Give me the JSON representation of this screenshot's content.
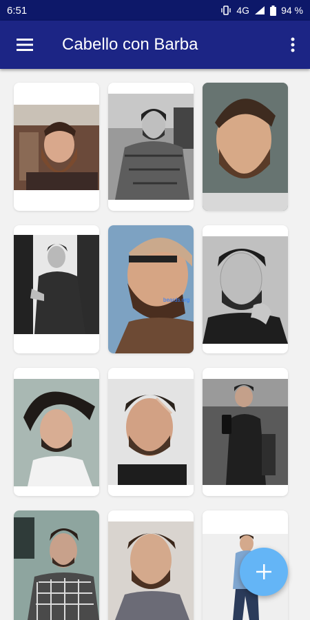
{
  "status_bar": {
    "time": "6:51",
    "network": "4G",
    "battery": "94 %",
    "icons": [
      "vibrate-icon",
      "signal-icon",
      "battery-icon"
    ]
  },
  "app_bar": {
    "title": "Cabello con Barba",
    "menu_icon": "hamburger-menu-icon",
    "overflow_icon": "more-vert-icon"
  },
  "gallery": {
    "watermark": "beards.org",
    "items": [
      {
        "name": "bearded-man-barbershop"
      },
      {
        "name": "bearded-man-plaid-shirt"
      },
      {
        "name": "bearded-man-side-part"
      },
      {
        "name": "man-glasses-suit"
      },
      {
        "name": "man-sunglasses-profile"
      },
      {
        "name": "bearded-man-hand-on-face"
      },
      {
        "name": "man-long-hair-windswept"
      },
      {
        "name": "man-fade-haircut"
      },
      {
        "name": "man-mirror-selfie"
      },
      {
        "name": "man-checkered-shirt"
      },
      {
        "name": "man-slick-back-beard"
      },
      {
        "name": "man-casual-outfit"
      }
    ]
  },
  "fab": {
    "icon": "plus-icon"
  },
  "colors": {
    "status_bar": "#0d1869",
    "app_bar": "#1c2585",
    "fab": "#64b5f6"
  }
}
